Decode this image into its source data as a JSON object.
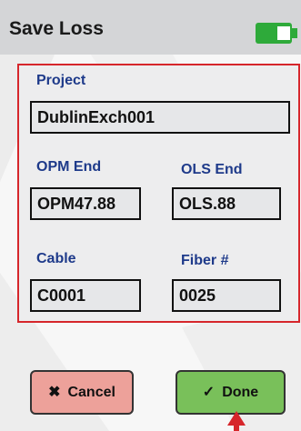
{
  "header": {
    "title": "Save Loss",
    "battery_color": "#2eaa3a"
  },
  "form": {
    "project": {
      "label": "Project",
      "value": "DublinExch001"
    },
    "opm_end": {
      "label": "OPM End",
      "value": "OPM47.88"
    },
    "ols_end": {
      "label": "OLS End",
      "value": "OLS.88"
    },
    "cable": {
      "label": "Cable",
      "value": "C0001"
    },
    "fiber": {
      "label": "Fiber #",
      "value": "0025"
    },
    "frame_color": "#d6262b",
    "label_color": "#1e3a8a"
  },
  "buttons": {
    "cancel": {
      "label": "Cancel",
      "icon": "x-icon",
      "color": "#eda19a"
    },
    "done": {
      "label": "Done",
      "icon": "checkmark-icon",
      "color": "#79c05a"
    }
  },
  "pointer": {
    "icon": "red-arrow-pointer",
    "color": "#d6262b"
  }
}
